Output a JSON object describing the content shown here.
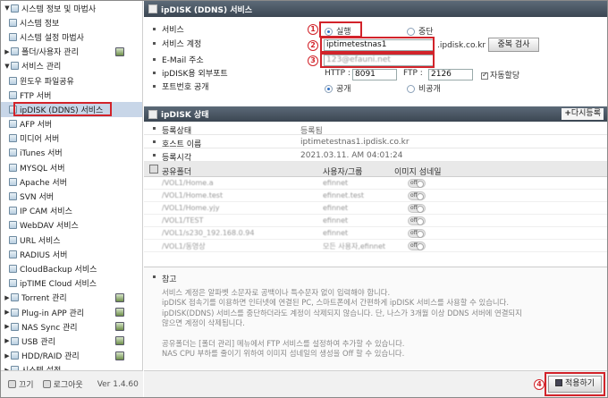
{
  "sidebar": {
    "items": [
      {
        "label": "시스템 정보 및 마법사",
        "type": "group",
        "arrow": "▼"
      },
      {
        "label": "시스템 정보",
        "type": "item"
      },
      {
        "label": "시스템 설정 마법사",
        "type": "item"
      },
      {
        "label": "폴더/사용자 관리",
        "type": "group",
        "arrow": "▶",
        "right_icon": true
      },
      {
        "label": "서비스 관리",
        "type": "group",
        "arrow": "▼"
      },
      {
        "label": "윈도우 파일공유",
        "type": "item"
      },
      {
        "label": "FTP 서버",
        "type": "item"
      },
      {
        "label": "ipDISK (DDNS) 서비스",
        "type": "item",
        "selected": true
      },
      {
        "label": "AFP 서버",
        "type": "item"
      },
      {
        "label": "미디어 서버",
        "type": "item"
      },
      {
        "label": "iTunes 서버",
        "type": "item"
      },
      {
        "label": "MYSQL 서버",
        "type": "item"
      },
      {
        "label": "Apache 서버",
        "type": "item"
      },
      {
        "label": "SVN 서버",
        "type": "item"
      },
      {
        "label": "IP CAM 서비스",
        "type": "item"
      },
      {
        "label": "WebDAV 서비스",
        "type": "item"
      },
      {
        "label": "URL 서비스",
        "type": "item"
      },
      {
        "label": "RADIUS 서버",
        "type": "item"
      },
      {
        "label": "CloudBackup 서비스",
        "type": "item"
      },
      {
        "label": "ipTIME Cloud 서비스",
        "type": "item"
      },
      {
        "label": "Torrent 관리",
        "type": "group",
        "arrow": "▶",
        "right_icon": true
      },
      {
        "label": "Plug-in APP 관리",
        "type": "group",
        "arrow": "▶",
        "right_icon": true
      },
      {
        "label": "NAS Sync 관리",
        "type": "group",
        "arrow": "▶",
        "right_icon": true
      },
      {
        "label": "USB 관리",
        "type": "group",
        "arrow": "▶",
        "right_icon": true
      },
      {
        "label": "HDD/RAID 관리",
        "type": "group",
        "arrow": "▶",
        "right_icon": true
      },
      {
        "label": "시스템 설정",
        "type": "group",
        "arrow": "▶"
      }
    ],
    "footer": {
      "off_label": "끄기",
      "logout_label": "로그아웃",
      "version": "Ver 1.4.60"
    }
  },
  "ddns": {
    "title": "ipDISK (DDNS) 서비스",
    "service_label": "서비스",
    "run_label": "실행",
    "stop_label": "중단",
    "account_label": "서비스 계정",
    "account_value": "iptimetestnas1",
    "domain_suffix": ".ipdisk.co.kr",
    "dup_check_label": "중복 검사",
    "email_label": "E-Mail 주소",
    "email_value": "123@efauni.net",
    "ports_label": "ipDISK용 외부포트",
    "http_label": "HTTP :",
    "http_value": "8091",
    "ftp_label": "FTP :",
    "ftp_value": "2126",
    "auto_assign_label": "자동할당",
    "port_public_label": "포트번호 공개",
    "public_label": "공개",
    "private_label": "비공개",
    "badges": [
      "1",
      "2",
      "3",
      "4"
    ]
  },
  "status": {
    "title": "ipDISK 상태",
    "reregister_label": "다시등록",
    "rows": [
      {
        "label": "등록상태",
        "value": "등록됨"
      },
      {
        "label": "호스트 이름",
        "value": "iptimetestnas1.ipdisk.co.kr"
      },
      {
        "label": "등록시각",
        "value": "2021.03.11. AM 04:01:24"
      }
    ]
  },
  "shares": {
    "col_folder": "공유폴더",
    "col_user": "사용자/그룹",
    "col_thumb": "이미지 섬네일",
    "rows": [
      {
        "path": "/VOL1/Home.a",
        "user": "efinnet",
        "toggle": "off"
      },
      {
        "path": "/VOL1/Home.test",
        "user": "efinnet.test",
        "toggle": "off"
      },
      {
        "path": "/VOL1/Home.yjy",
        "user": "efinnet",
        "toggle": "off"
      },
      {
        "path": "/VOL1/TEST",
        "user": "efinnet",
        "toggle": "off"
      },
      {
        "path": "/VOL1/s230_192.168.0.94",
        "user": "efinnet",
        "toggle": "off"
      },
      {
        "path": "/VOL1/동영상",
        "user": "모든 사용자,efinnet",
        "toggle": "off"
      }
    ]
  },
  "note": {
    "title": "참고",
    "lines": [
      "서비스 계정은 알파벳 소문자로 공백이나 특수문자 없이 입력해야 합니다.",
      "ipDISK 접속기를 이용하면 인터넷에 연결된 PC, 스마트폰에서 간편하게 ipDISK 서비스를 사용할 수 있습니다.",
      "ipDISK(DDNS) 서비스를 중단하더라도 계정이 삭제되지 않습니다. 단, 나스가 3개월 이상 DDNS 서버에 연결되지",
      "않으면 계정이 삭제됩니다.",
      "",
      "공유폴더는 [폴더 관리] 메뉴에서 FTP 서비스를 설정하여 추가할 수 있습니다.",
      "NAS CPU 부하를 줄이기 위하여 이미지 섬네일의 생성을 Off 할 수 있습니다."
    ]
  },
  "apply_label": "적용하기"
}
